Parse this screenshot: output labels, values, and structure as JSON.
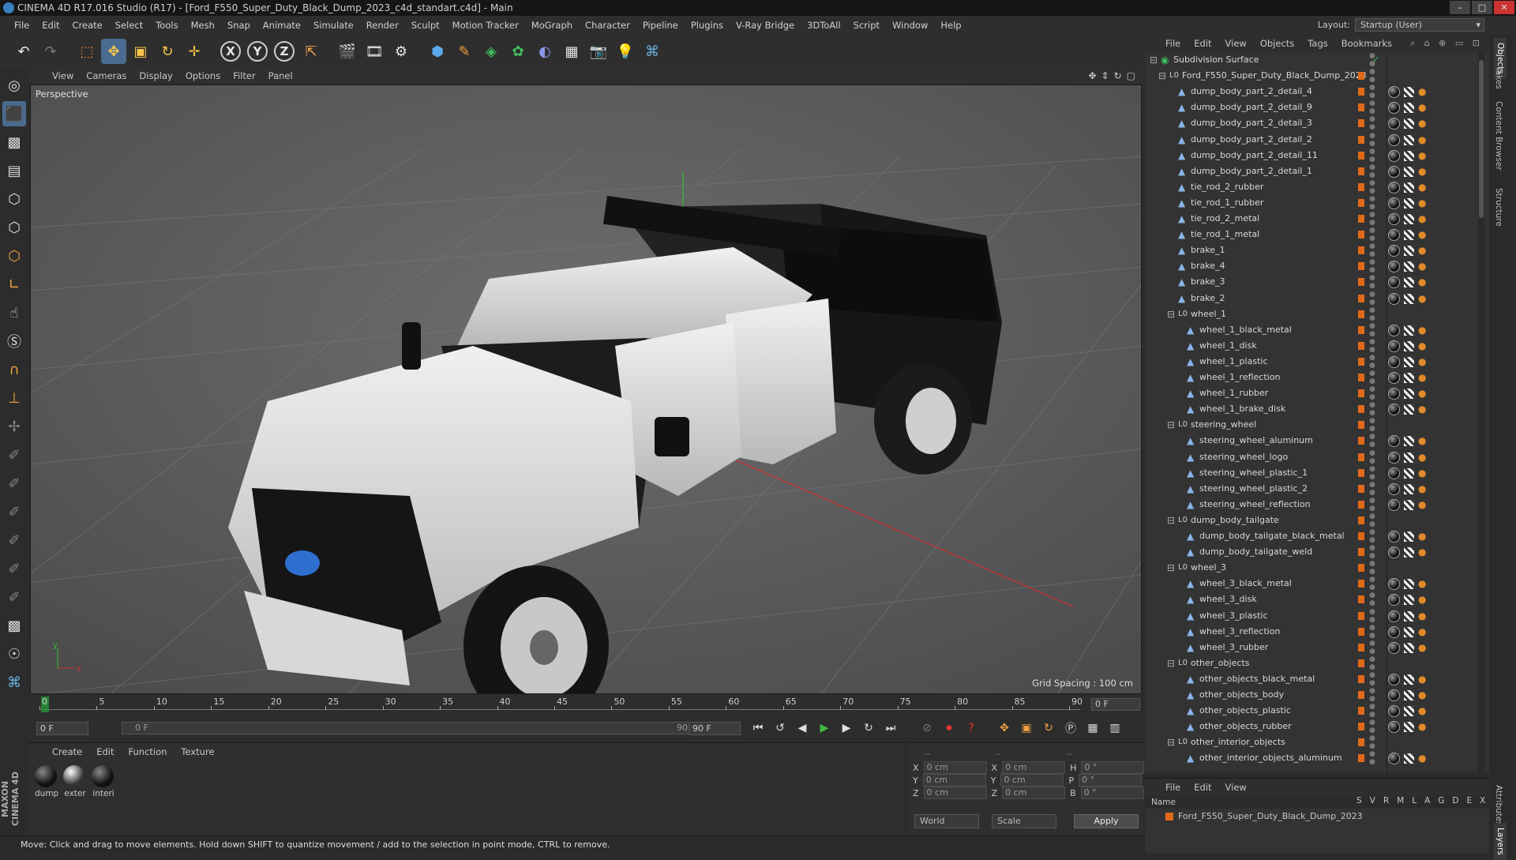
{
  "window": {
    "title": "CINEMA 4D R17.016 Studio (R17) - [Ford_F550_Super_Duty_Black_Dump_2023_c4d_standart.c4d] - Main"
  },
  "menu": [
    "File",
    "Edit",
    "Create",
    "Select",
    "Tools",
    "Mesh",
    "Snap",
    "Animate",
    "Simulate",
    "Render",
    "Sculpt",
    "Motion Tracker",
    "MoGraph",
    "Character",
    "Pipeline",
    "Plugins",
    "V-Ray Bridge",
    "3DToAll",
    "Script",
    "Window",
    "Help"
  ],
  "layout": {
    "label": "Layout:",
    "value": "Startup (User)"
  },
  "viewport": {
    "menu": [
      "View",
      "Cameras",
      "Display",
      "Options",
      "Filter",
      "Panel"
    ],
    "camera_label": "Perspective",
    "grid_spacing": "Grid Spacing : 100 cm"
  },
  "timeline": {
    "ticks": [
      "0",
      "5",
      "10",
      "15",
      "20",
      "25",
      "30",
      "35",
      "40",
      "45",
      "50",
      "55",
      "60",
      "65",
      "70",
      "75",
      "80",
      "85",
      "90"
    ],
    "current_frame": "0 F"
  },
  "transport": {
    "start": "0 F",
    "slider_start": "0 F",
    "slider_end": "90 F",
    "end": "90 F"
  },
  "material_manager": {
    "menu": [
      "Create",
      "Edit",
      "Function",
      "Texture"
    ],
    "materials": [
      {
        "label": "dump"
      },
      {
        "label": "exter"
      },
      {
        "label": "interi"
      }
    ]
  },
  "coordinates": {
    "header": [
      "--",
      "--",
      "--"
    ],
    "rows": [
      {
        "a": "X",
        "av": "0 cm",
        "b": "X",
        "bv": "0 cm",
        "c": "H",
        "cv": "0 °"
      },
      {
        "a": "Y",
        "av": "0 cm",
        "b": "Y",
        "bv": "0 cm",
        "c": "P",
        "cv": "0 °"
      },
      {
        "a": "Z",
        "av": "0 cm",
        "b": "Z",
        "bv": "0 cm",
        "c": "B",
        "cv": "0 °"
      }
    ],
    "space": "World",
    "mode": "Scale",
    "apply": "Apply"
  },
  "status": "Move: Click and drag to move elements. Hold down SHIFT to quantize movement / add to the selection in point mode, CTRL to remove.",
  "brand": "MAXON CINEMA 4D",
  "object_manager": {
    "menu": [
      "File",
      "Edit",
      "View",
      "Objects",
      "Tags",
      "Bookmarks"
    ],
    "objects": [
      {
        "name": "Subdivision Surface",
        "level": 0,
        "type": "subdiv"
      },
      {
        "name": "Ford_F550_Super_Duty_Black_Dump_2023",
        "level": 1,
        "type": "null"
      },
      {
        "name": "dump_body_part_2_detail_4",
        "level": 2,
        "type": "mesh"
      },
      {
        "name": "dump_body_part_2_detail_9",
        "level": 2,
        "type": "mesh"
      },
      {
        "name": "dump_body_part_2_detail_3",
        "level": 2,
        "type": "mesh"
      },
      {
        "name": "dump_body_part_2_detail_2",
        "level": 2,
        "type": "mesh"
      },
      {
        "name": "dump_body_part_2_detail_11",
        "level": 2,
        "type": "mesh"
      },
      {
        "name": "dump_body_part_2_detail_1",
        "level": 2,
        "type": "mesh"
      },
      {
        "name": "tie_rod_2_rubber",
        "level": 2,
        "type": "mesh"
      },
      {
        "name": "tie_rod_1_rubber",
        "level": 2,
        "type": "mesh"
      },
      {
        "name": "tie_rod_2_metal",
        "level": 2,
        "type": "mesh"
      },
      {
        "name": "tie_rod_1_metal",
        "level": 2,
        "type": "mesh"
      },
      {
        "name": "brake_1",
        "level": 2,
        "type": "mesh"
      },
      {
        "name": "brake_4",
        "level": 2,
        "type": "mesh"
      },
      {
        "name": "brake_3",
        "level": 2,
        "type": "mesh"
      },
      {
        "name": "brake_2",
        "level": 2,
        "type": "mesh"
      },
      {
        "name": "wheel_1",
        "level": 2,
        "type": "null"
      },
      {
        "name": "wheel_1_black_metal",
        "level": 3,
        "type": "mesh"
      },
      {
        "name": "wheel_1_disk",
        "level": 3,
        "type": "mesh"
      },
      {
        "name": "wheel_1_plastic",
        "level": 3,
        "type": "mesh"
      },
      {
        "name": "wheel_1_reflection",
        "level": 3,
        "type": "mesh"
      },
      {
        "name": "wheel_1_rubber",
        "level": 3,
        "type": "mesh"
      },
      {
        "name": "wheel_1_brake_disk",
        "level": 3,
        "type": "mesh"
      },
      {
        "name": "steering_wheel",
        "level": 2,
        "type": "null"
      },
      {
        "name": "steering_wheel_aluminum",
        "level": 3,
        "type": "mesh"
      },
      {
        "name": "steering_wheel_logo",
        "level": 3,
        "type": "mesh"
      },
      {
        "name": "steering_wheel_plastic_1",
        "level": 3,
        "type": "mesh"
      },
      {
        "name": "steering_wheel_plastic_2",
        "level": 3,
        "type": "mesh"
      },
      {
        "name": "steering_wheel_reflection",
        "level": 3,
        "type": "mesh"
      },
      {
        "name": "dump_body_tailgate",
        "level": 2,
        "type": "null"
      },
      {
        "name": "dump_body_tailgate_black_metal",
        "level": 3,
        "type": "mesh"
      },
      {
        "name": "dump_body_tailgate_weld",
        "level": 3,
        "type": "mesh"
      },
      {
        "name": "wheel_3",
        "level": 2,
        "type": "null"
      },
      {
        "name": "wheel_3_black_metal",
        "level": 3,
        "type": "mesh"
      },
      {
        "name": "wheel_3_disk",
        "level": 3,
        "type": "mesh"
      },
      {
        "name": "wheel_3_plastic",
        "level": 3,
        "type": "mesh"
      },
      {
        "name": "wheel_3_reflection",
        "level": 3,
        "type": "mesh"
      },
      {
        "name": "wheel_3_rubber",
        "level": 3,
        "type": "mesh"
      },
      {
        "name": "other_objects",
        "level": 2,
        "type": "null"
      },
      {
        "name": "other_objects_black_metal",
        "level": 3,
        "type": "mesh"
      },
      {
        "name": "other_objects_body",
        "level": 3,
        "type": "mesh"
      },
      {
        "name": "other_objects_plastic",
        "level": 3,
        "type": "mesh"
      },
      {
        "name": "other_objects_rubber",
        "level": 3,
        "type": "mesh"
      },
      {
        "name": "other_interior_objects",
        "level": 2,
        "type": "null"
      },
      {
        "name": "other_interior_objects_aluminum",
        "level": 3,
        "type": "mesh"
      }
    ]
  },
  "layer_manager": {
    "menu": [
      "File",
      "Edit",
      "View"
    ],
    "columns_label": "Name",
    "columns": [
      "S",
      "V",
      "R",
      "M",
      "L",
      "A",
      "G",
      "D",
      "E",
      "X"
    ],
    "layers": [
      {
        "name": "Ford_F550_Super_Duty_Black_Dump_2023"
      }
    ]
  },
  "right_tabs": [
    "Objects",
    "Takes",
    "Content Browser",
    "Structure"
  ],
  "right_tabs_bottom": [
    "Attributes",
    "Layers"
  ],
  "colors": {
    "accent_orange": "#e06a1a",
    "axis_x": "#d03030",
    "axis_y": "#30c030",
    "play_green": "#3fbf3f"
  }
}
